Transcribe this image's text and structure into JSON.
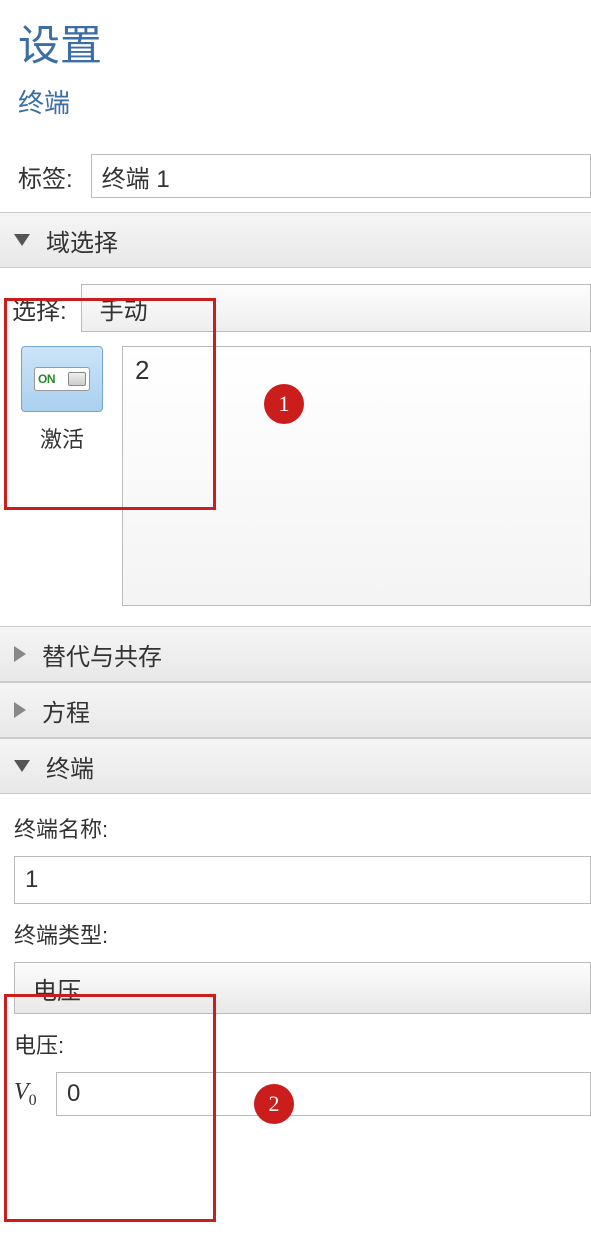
{
  "header": {
    "title": "设置",
    "subtitle": "终端"
  },
  "label_row": {
    "label": "标签:",
    "value": "终端 1"
  },
  "sections": {
    "domain_select": {
      "title": "域选择",
      "select_label": "选择:",
      "select_value": "手动",
      "activate_label": "激活",
      "toggle_state": "ON",
      "domain_list_value": "2"
    },
    "override": {
      "title": "替代与共存"
    },
    "equation": {
      "title": "方程"
    },
    "terminal": {
      "title": "终端",
      "name_label": "终端名称:",
      "name_value": "1",
      "type_label": "终端类型:",
      "type_value": "电压",
      "voltage_label": "电压:",
      "voltage_symbol_var": "V",
      "voltage_symbol_sub": "0",
      "voltage_value": "0"
    }
  },
  "annotations": {
    "badge1": "1",
    "badge2": "2"
  }
}
